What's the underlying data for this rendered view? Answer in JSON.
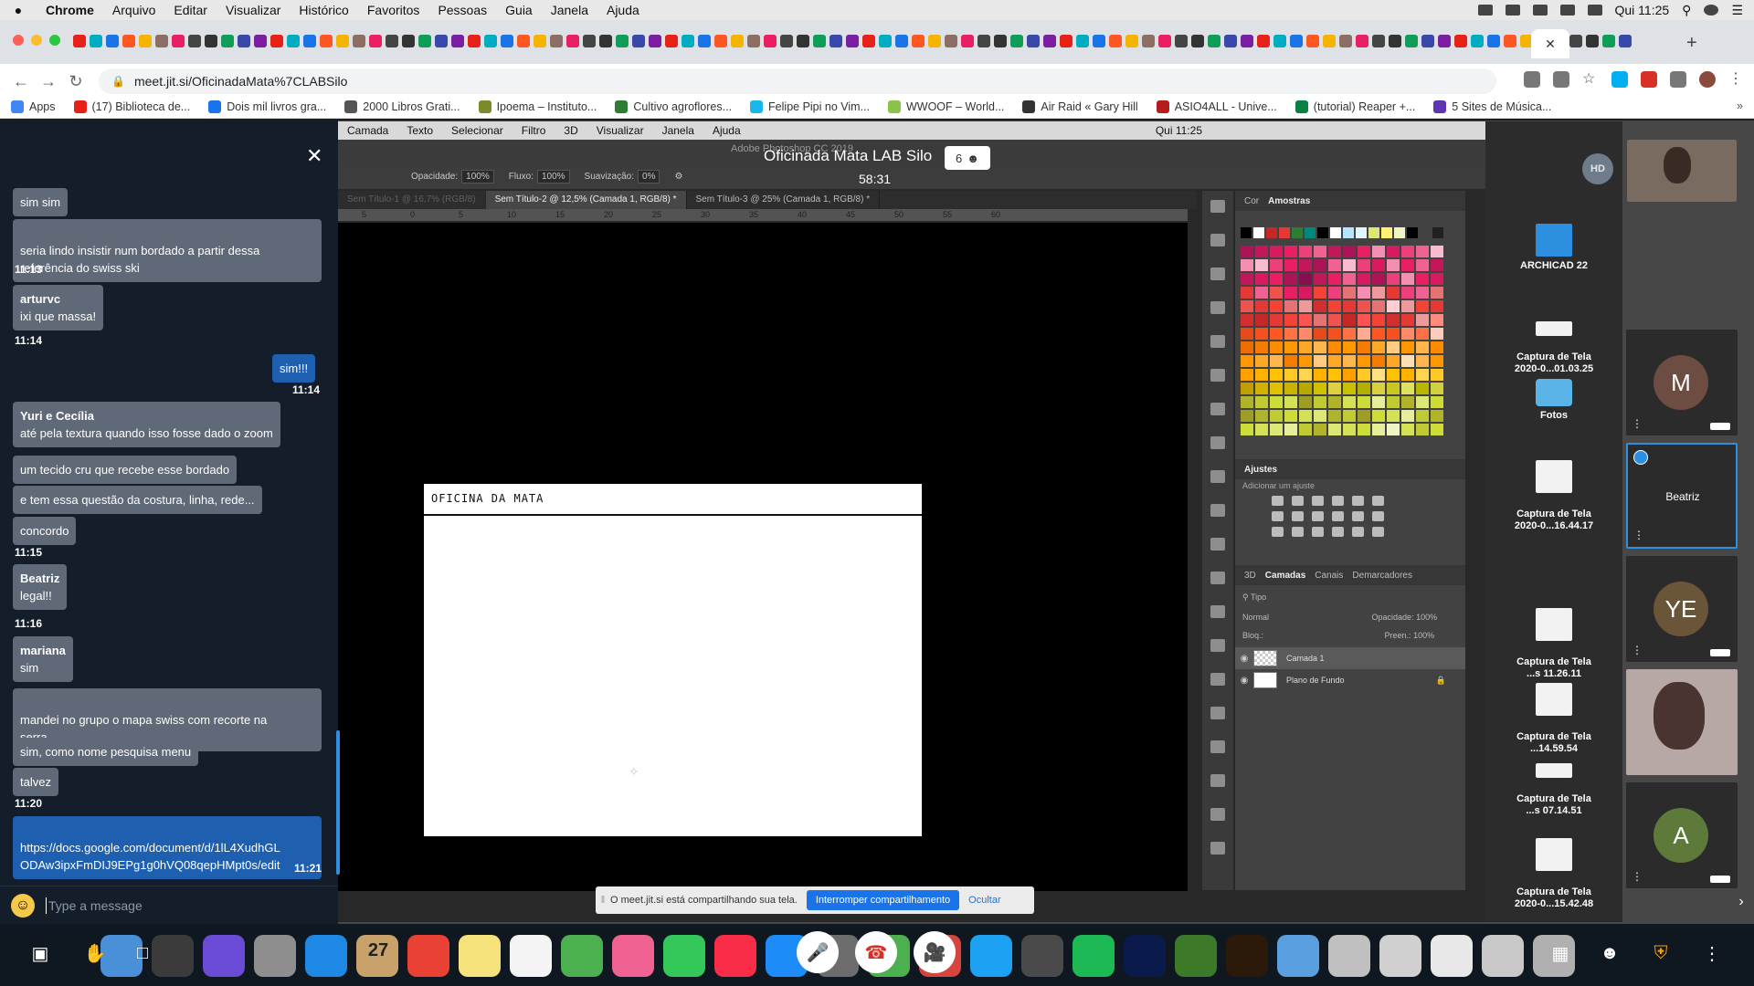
{
  "menubar": {
    "app": "Chrome",
    "items": [
      "Arquivo",
      "Editar",
      "Visualizar",
      "Histórico",
      "Favoritos",
      "Pessoas",
      "Guia",
      "Janela",
      "Ajuda"
    ],
    "clock": "Qui 11:25"
  },
  "browser": {
    "active_tab_icon": "close-icon",
    "url": "meet.jit.si/OficinadaMata%7CLABSilo",
    "bookmarks": [
      {
        "label": "Apps",
        "color": "#4285f4"
      },
      {
        "label": "(17) Biblioteca de...",
        "color": "#e62117"
      },
      {
        "label": "Dois mil livros gra...",
        "color": "#1a73e8"
      },
      {
        "label": "2000 Libros Grati...",
        "color": "#555555"
      },
      {
        "label": "Ipoema – Instituto...",
        "color": "#7a8b2b"
      },
      {
        "label": "Cultivo agroflores...",
        "color": "#2e7d32"
      },
      {
        "label": "Felipe Pipi no Vim...",
        "color": "#1ab7ea"
      },
      {
        "label": "WWOOF – World...",
        "color": "#8bc34a"
      },
      {
        "label": "Air Raid « Gary Hill",
        "color": "#333333"
      },
      {
        "label": "ASIO4ALL - Unive...",
        "color": "#b71c1c"
      },
      {
        "label": "(tutorial) Reaper +...",
        "color": "#0b8043"
      },
      {
        "label": "5 Sites de Música...",
        "color": "#5e35b1"
      }
    ]
  },
  "meeting": {
    "title": "Oficinada Mata LAB Silo",
    "participants": "6",
    "timer": "58:31"
  },
  "photoshop": {
    "menu": [
      "Camada",
      "Texto",
      "Selecionar",
      "Filtro",
      "3D",
      "Visualizar",
      "Janela",
      "Ajuda"
    ],
    "clock": "Qui 11:25",
    "app_title": "Adobe Photoshop CC 2019",
    "options": {
      "opacity_label": "Opacidade:",
      "opacity": "100%",
      "flow_label": "Fluxo:",
      "flow": "100%",
      "smoothing_label": "Suavização:",
      "smoothing": "0%"
    },
    "tabs": [
      "Sem Título-1 @ 16,7% (RGB/8)",
      "Sem Título-2 @ 12,5% (Camada 1, RGB/8) *",
      "Sem Título-3 @ 25% (Camada 1, RGB/8) *"
    ],
    "ruler": [
      "5",
      "0",
      "5",
      "10",
      "15",
      "20",
      "25",
      "30",
      "35",
      "40",
      "45",
      "50",
      "55",
      "60"
    ],
    "canvas_text": "OFICINA DA MATA",
    "panels": {
      "color_tab": "Cor",
      "swatches_tab": "Amostras",
      "adjustments_title": "Ajustes",
      "adjustments_hint": "Adicionar um ajuste",
      "layers_tabs": [
        "3D",
        "Camadas",
        "Canais",
        "Demarcadores"
      ],
      "kind_filter": "Tipo",
      "blend_mode": "Normal",
      "opacity_label": "Opacidade:",
      "opacity": "100%",
      "lock_label": "Bloq.:",
      "fill_label": "Preen.:",
      "fill": "100%",
      "layers": [
        "Camada 1",
        "Plano de Fundo"
      ]
    }
  },
  "share_notice": {
    "text": "O meet.jit.si está compartilhando sua tela.",
    "stop": "Interromper compartilhamento",
    "hide": "Ocultar"
  },
  "desktop_files": [
    "ARCHICAD 22",
    "Captura de Tela\n2020-0...01.03.25",
    "Fotos",
    "Captura de Tela\n2020-0...16.44.17",
    "Captura de Tela\n...s 11.26.11",
    "Captura de Tela\n...14.59.54",
    "Captura de Tela\n...s 07.14.51",
    "Captura de Tela\n2020-0...15.42.48"
  ],
  "participants": {
    "hd_initials": "HD",
    "m_initial": "M",
    "active_name": "Beatriz",
    "ye_initials": "YE",
    "a_initial": "A"
  },
  "chat": {
    "messages": [
      {
        "text": "sim sim"
      },
      {
        "text": "seria lindo insistir num bordado a partir dessa\nreferência do swiss ski"
      },
      {
        "time": "11:13"
      },
      {
        "sender": "arturvc",
        "text": "ixi que massa!"
      },
      {
        "time": "11:14"
      },
      {
        "text": "sim!!!",
        "own": true
      },
      {
        "time": "11:14"
      },
      {
        "sender": "Yuri e Cecília",
        "text": "até pela textura quando isso fosse dado o zoom"
      },
      {
        "text": "um tecido cru que recebe esse bordado"
      },
      {
        "text": "e tem essa questão da costura, linha, rede..."
      },
      {
        "text": "concordo"
      },
      {
        "time": "11:15"
      },
      {
        "sender": "Beatriz",
        "text": "legal!!"
      },
      {
        "time": "11:16"
      },
      {
        "sender": "mariana",
        "text": "sim"
      },
      {
        "text": "mandei no grupo o mapa swiss com recorte na\nserra"
      },
      {
        "text": "sim, como nome pesquisa menu"
      },
      {
        "text": "talvez"
      },
      {
        "time": "11:20"
      },
      {
        "text": "https://docs.google.com/document/d/1lL4XudhGL\nODAw3ipxFmDIJ9EPg1g0hVQ08qepHMpt0s/edit",
        "link": true
      },
      {
        "time": "11:21"
      }
    ],
    "input_placeholder": "Type a message"
  },
  "dock_date": "27"
}
